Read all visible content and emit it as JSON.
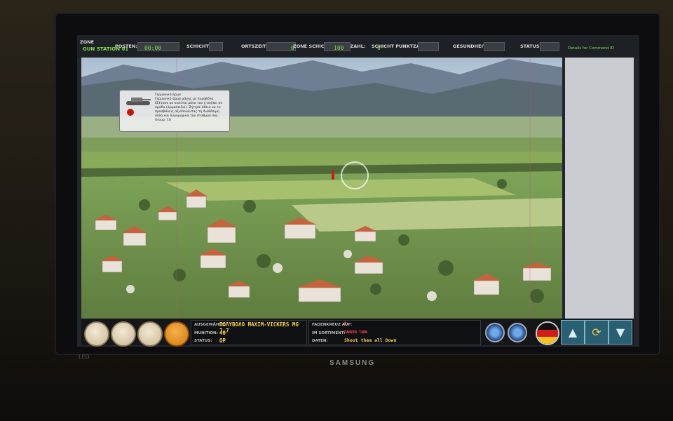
{
  "hud": {
    "zone_label": "ZONE",
    "station_label": "GUN STATION 01",
    "posten_label": "POSTEN:",
    "posten_value": "00:00",
    "schicht_label": "SCHICHT:",
    "ortszeit_label": "ORTSZEIT:",
    "zone_punktzahl_label": "ZONE SCHICHT PUNKTZAHL:",
    "zone_punktzahl_value": "0",
    "zone_punktzahl_value2": "100",
    "schicht_punktzahl_label": "SCHICHT PUNKTZAHL:",
    "schicht_punktzahl_value": "0",
    "gesundheit_label": "GESUNDHEIT:",
    "status_label": "STATUS:",
    "command_label": "Details for Command ID"
  },
  "info_card": {
    "text": "Γερμανικό άρμα\nΓερμανικό άρμα μάχης με πυροβόλο. Εξέτασε αν κινείται μόνο του ή ανήκει σε ομάδα (άρμα/πεζοί). Ζήτησε άδεια να το προσβάλεις αξιοποιώντας τη διαθέσιμη όπλα και πυρομαχικά του σταθμού σας.\nGroup: 10"
  },
  "weapon_panel": {
    "selected_label": "AUSGEWÄHLT:",
    "selected_value": "ΠΟΛΥΒΟΛΟ MAXIM-VICKERS MG 7.7",
    "munition_label": "MUNITION:",
    "munition_value": "40",
    "status_label": "STATUS:",
    "status_value": "OP"
  },
  "target_panel": {
    "fadenkreuz_label": "FADENKREUZ AUF:",
    "fadenkreuz_value": "R",
    "sortiment_label": "IM SORTIMENT:",
    "sortiment_value": "PANZER TANK",
    "daten_label": "DATEN:",
    "daten_value": "Shoot them all Down"
  },
  "bezel": {
    "brand": "SAMSUNG",
    "led": "LED"
  },
  "icons": [
    "binoculars-icon",
    "german-flag-icon",
    "arrow-up-icon",
    "rotate-icon",
    "arrow-down-icon"
  ],
  "colors": {
    "hud_green": "#7de04a",
    "hud_yellow": "#f6d24a",
    "nav_teal": "#2a5f73"
  }
}
